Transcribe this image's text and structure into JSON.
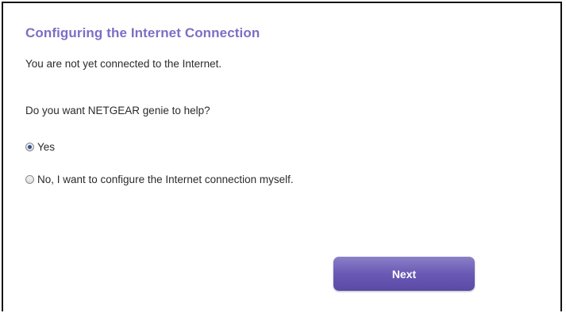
{
  "title": "Configuring the Internet Connection",
  "status_text": "You are not yet connected to the Internet.",
  "question": "Do you want NETGEAR genie to help?",
  "options": [
    {
      "label": "Yes",
      "selected": true
    },
    {
      "label": "No, I want to configure the Internet connection myself.",
      "selected": false
    }
  ],
  "next_label": "Next",
  "colors": {
    "title": "#7b6fc6",
    "button": "#6a5ab5",
    "radio_dot": "#2f4f96"
  }
}
